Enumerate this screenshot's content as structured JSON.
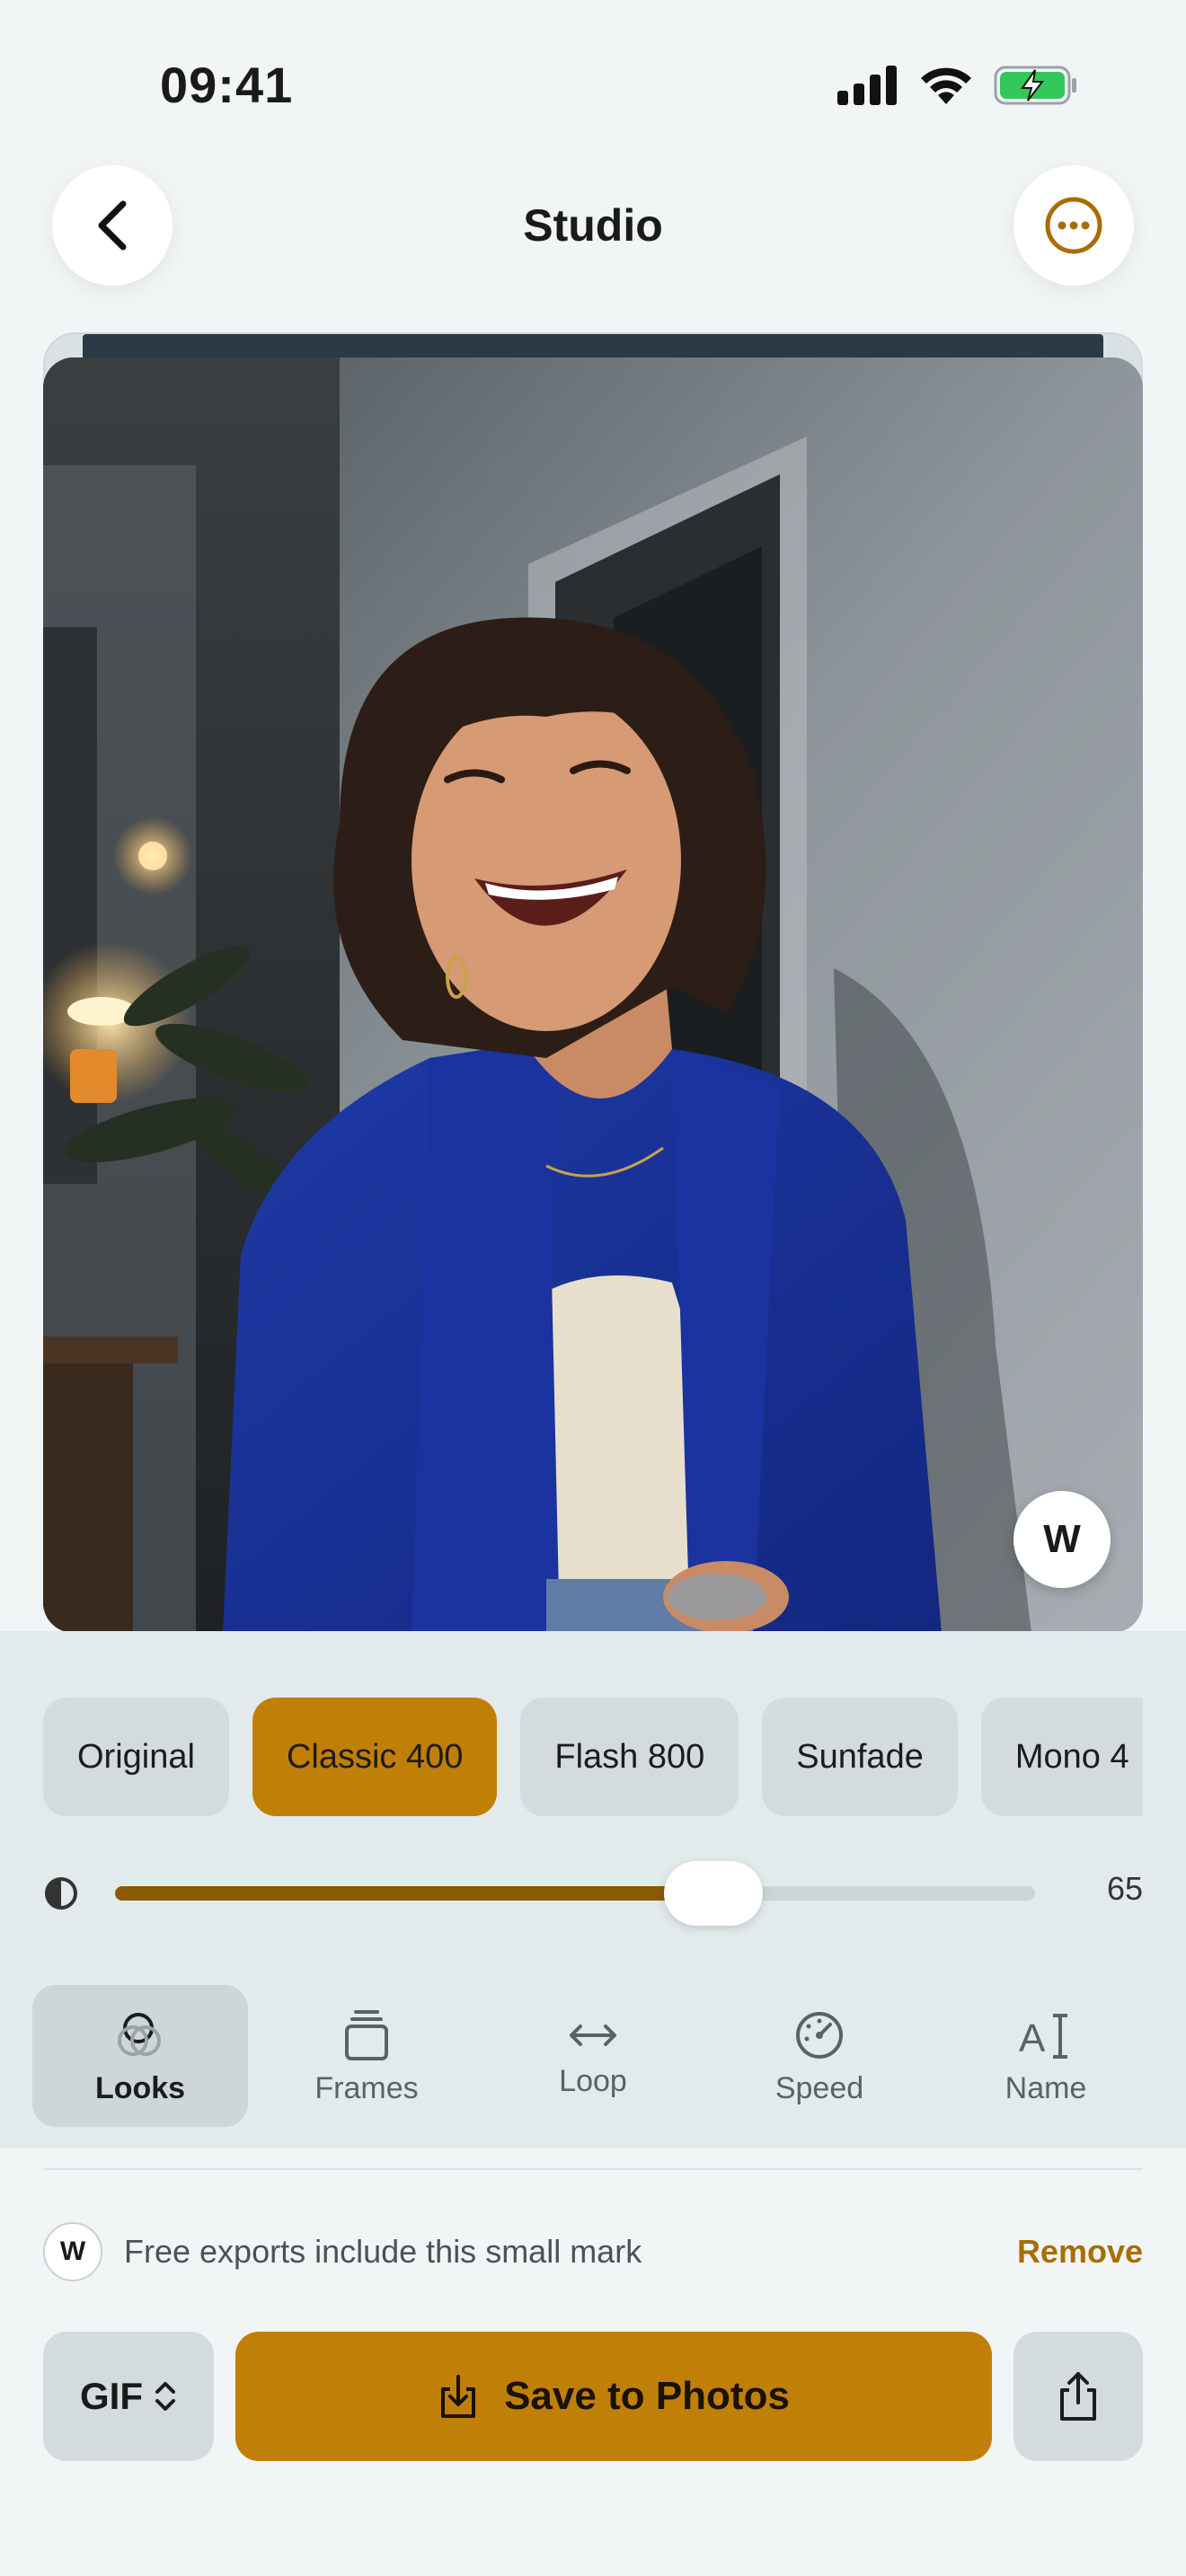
{
  "status_bar": {
    "time": "09:41"
  },
  "header": {
    "title": "Studio"
  },
  "photo": {
    "watermark_letter": "W"
  },
  "looks": {
    "items": [
      "Original",
      "Classic 400",
      "Flash 800",
      "Sunfade",
      "Mono 4"
    ],
    "active_index": 1
  },
  "intensity": {
    "value": 65,
    "label": "65"
  },
  "tabs": [
    {
      "label": "Looks",
      "icon": "looks-icon"
    },
    {
      "label": "Frames",
      "icon": "frames-icon"
    },
    {
      "label": "Loop",
      "icon": "loop-icon"
    },
    {
      "label": "Speed",
      "icon": "speed-icon"
    },
    {
      "label": "Name",
      "icon": "text-name-icon"
    }
  ],
  "watermark_notice": {
    "badge": "W",
    "text": "Free exports include this small mark",
    "action": "Remove"
  },
  "actions": {
    "format": "GIF",
    "save": "Save to Photos"
  },
  "colors": {
    "accent": "#c07f06",
    "background": "#f2f5f6",
    "panel": "#e3eaec"
  }
}
